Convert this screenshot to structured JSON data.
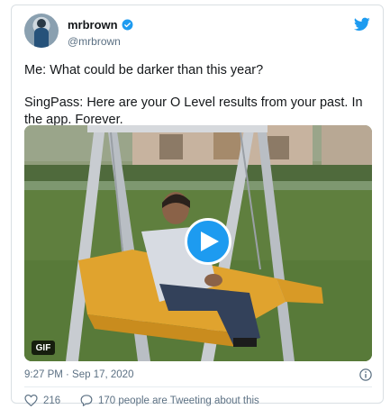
{
  "tweet": {
    "display_name": "mrbrown",
    "handle": "@mrbrown",
    "verified_icon": "verified-badge-icon",
    "brand_icon": "twitter-bird-icon",
    "text_lines": [
      "Me: What could be darker than this year?",
      "SingPass: Here are your O Level results from your past. In the app. Forever."
    ],
    "media": {
      "badge": "GIF",
      "play_icon": "play-icon"
    },
    "timestamp": "9:27 PM · Sep 17, 2020",
    "likes": "216",
    "conversation": "170 people are Tweeting about this"
  },
  "colors": {
    "accent": "#1d9bf0",
    "text": "#14171a",
    "muted": "#5b7083",
    "border": "#d9dfe3"
  }
}
